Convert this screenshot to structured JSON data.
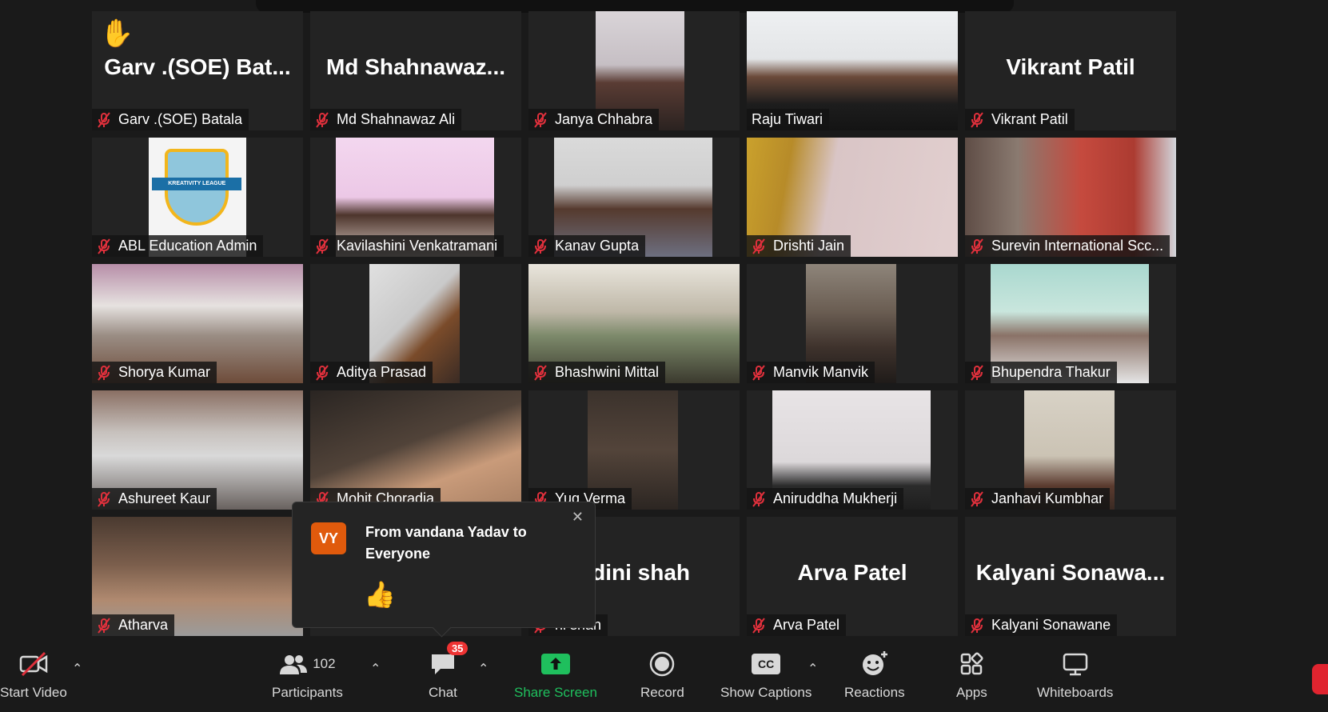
{
  "participants_grid": [
    {
      "label": "Garv .(SOE) Batala",
      "big_name": "Garv .(SOE) Bat...",
      "hand_raised": true,
      "video": null,
      "video_style": ""
    },
    {
      "label": "Md Shahnawaz Ali",
      "big_name": "Md Shahnawaz...",
      "hand_raised": false,
      "video": null,
      "video_style": ""
    },
    {
      "label": "Janya Chhabra",
      "big_name": "",
      "hand_raised": false,
      "video": "v-girl",
      "video_style": "left:32%;width:42%;"
    },
    {
      "label": "Raju Tiwari",
      "big_name": "",
      "hand_raised": false,
      "video": "v-raju",
      "video_style": "left:0;width:100%;",
      "active_speaker": true,
      "mic_muted": false
    },
    {
      "label": "Vikrant Patil",
      "big_name": "Vikrant Patil",
      "hand_raised": false,
      "video": null,
      "video_style": ""
    },
    {
      "label": "ABL Education Admin",
      "big_name": "",
      "hand_raised": false,
      "video": "v-logo",
      "video_style": "left:27%;width:46%;",
      "logo_text": "KREATIVITY LEAGUE"
    },
    {
      "label": "Kavilashini Venkatramani",
      "big_name": "",
      "hand_raised": false,
      "video": "v-kavil",
      "video_style": "left:12%;width:75%;"
    },
    {
      "label": "Kanav Gupta",
      "big_name": "",
      "hand_raised": false,
      "video": "v-kanav",
      "video_style": "left:12%;width:75%;"
    },
    {
      "label": "Drishti Jain",
      "big_name": "",
      "hand_raised": false,
      "video": "v-drishti",
      "video_style": "left:0;width:100%;"
    },
    {
      "label": "Surevin International Scc...",
      "big_name": "",
      "hand_raised": false,
      "video": "v-surevin",
      "video_style": "left:0;width:100%;"
    },
    {
      "label": "Shorya Kumar",
      "big_name": "",
      "hand_raised": false,
      "video": "v-shorya",
      "video_style": "left:0;width:100%;"
    },
    {
      "label": "Aditya Prasad",
      "big_name": "",
      "hand_raised": false,
      "video": "v-aditya",
      "video_style": "left:28%;width:43%;"
    },
    {
      "label": "Bhashwini Mittal",
      "big_name": "",
      "hand_raised": false,
      "video": "v-bhash",
      "video_style": "left:0;width:100%;"
    },
    {
      "label": "Manvik Manvik",
      "big_name": "",
      "hand_raised": false,
      "video": "v-manvik",
      "video_style": "left:28%;width:43%;"
    },
    {
      "label": "Bhupendra Thakur",
      "big_name": "",
      "hand_raised": false,
      "video": "v-bhupen",
      "video_style": "left:12%;width:75%;"
    },
    {
      "label": "Ashureet Kaur",
      "big_name": "",
      "hand_raised": false,
      "video": "v-ashu",
      "video_style": "left:0;width:100%;"
    },
    {
      "label": "Mohit Choradia",
      "big_name": "",
      "hand_raised": false,
      "video": "v-mohit",
      "video_style": "left:0;width:100%;"
    },
    {
      "label": "Yug Verma",
      "big_name": "",
      "hand_raised": false,
      "video": "v-yug",
      "video_style": "left:28%;width:43%;"
    },
    {
      "label": "Aniruddha Mukherji",
      "big_name": "",
      "hand_raised": false,
      "video": "v-anir",
      "video_style": "left:12%;width:75%;"
    },
    {
      "label": "Janhavi Kumbhar",
      "big_name": "",
      "hand_raised": false,
      "video": "v-janhavi",
      "video_style": "left:28%;width:43%;"
    },
    {
      "label": "Atharva",
      "big_name": "",
      "hand_raised": false,
      "video": "v-atharva",
      "video_style": "left:0;width:100%;"
    },
    {
      "label": "",
      "big_name": "",
      "hand_raised": false,
      "video": null,
      "video_style": "",
      "hidden_by_popup": true
    },
    {
      "label": "ni shah",
      "big_name": "ndini shah",
      "hand_raised": false,
      "video": null,
      "video_style": ""
    },
    {
      "label": "Arva Patel",
      "big_name": "Arva Patel",
      "hand_raised": false,
      "video": null,
      "video_style": ""
    },
    {
      "label": "Kalyani Sonawane",
      "big_name": "Kalyani Sonawa...",
      "hand_raised": false,
      "video": null,
      "video_style": ""
    }
  ],
  "chat_popup": {
    "avatar_initials": "VY",
    "title": "From vandana Yadav to Everyone",
    "message": "👍",
    "close_glyph": "✕"
  },
  "toolbar": {
    "start_video": "Start Video",
    "participants": "Participants",
    "participants_count": "102",
    "chat": "Chat",
    "chat_badge": "35",
    "share_screen": "Share Screen",
    "record": "Record",
    "show_captions": "Show Captions",
    "captions_icon_text": "CC",
    "reactions": "Reactions",
    "apps": "Apps",
    "whiteboards": "Whiteboards"
  },
  "colors": {
    "active_speaker_border": "#c8f04c",
    "mute_red": "#e0303c",
    "share_green": "#1fbf5d",
    "avatar_orange": "#e05a0c"
  }
}
